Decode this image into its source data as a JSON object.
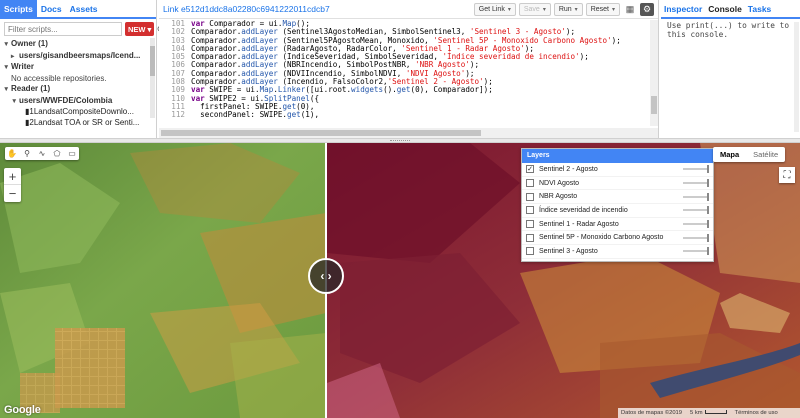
{
  "left_panel": {
    "tabs": [
      "Scripts",
      "Docs",
      "Assets"
    ],
    "filter_placeholder": "Filter scripts...",
    "new_button": "NEW",
    "owner": "Owner (1)",
    "owner_repo": "users/gisandbeersmaps/Icend...",
    "writer": "Writer",
    "writer_empty": "No accessible repositories.",
    "reader": "Reader (1)",
    "reader_repo": "users/WWFDE/Colombia",
    "file1": "1LandsatCompositeDownlo...",
    "file2": "2Landsat TOA or SR or Senti..."
  },
  "center_panel": {
    "link_title": "Link e512d1ddc8a02280c6941222011cdcb7",
    "get_link": "Get Link",
    "save": "Save",
    "run": "Run",
    "reset": "Reset",
    "code_lines": [
      {
        "n": "101",
        "t": "var Comparador = ui.Map();"
      },
      {
        "n": "102",
        "t": "Comparador.addLayer (Sentinel3AgostoMedian, SimbolSentinel3, 'Sentinel 3 - Agosto');"
      },
      {
        "n": "103",
        "t": "Comparador.addLayer (Sentinel5PAgostoMean, Monoxido, 'Sentinel 5P - Monoxido Carbono Agosto');"
      },
      {
        "n": "104",
        "t": "Comparador.addLayer (RadarAgosto, RadarColor, 'Sentinel 1 - Radar Agosto');"
      },
      {
        "n": "105",
        "t": "Comparador.addLayer (IndiceSeveridad, SimbolSeveridad, 'Índice severidad de incendio');"
      },
      {
        "n": "106",
        "t": "Comparador.addLayer (NBRIncendio, SimbolPostNBR, 'NBR Agosto');"
      },
      {
        "n": "107",
        "t": "Comparador.addLayer (NDVIIncendio, SimbolNDVI, 'NDVI Agosto');"
      },
      {
        "n": "108",
        "t": "Comparador.addLayer (Incendio, FalsoColor2,'Sentinel 2 - Agosto');"
      },
      {
        "n": "109",
        "t": "var SWIPE = ui.Map.Linker([ui.root.widgets().get(0), Comparador]);"
      },
      {
        "n": "110",
        "t": "var SWIPE2 = ui.SplitPanel({"
      },
      {
        "n": "111",
        "t": "  firstPanel: SWIPE.get(0),"
      },
      {
        "n": "112",
        "t": "  secondPanel: SWIPE.get(1),"
      }
    ]
  },
  "right_panel": {
    "tabs": [
      "Inspector",
      "Console",
      "Tasks"
    ],
    "console_text": "Use print(...) to write to this console."
  },
  "map": {
    "layers_title": "Layers",
    "layers": [
      {
        "name": "Sentinel 2 - Agosto",
        "checked": true
      },
      {
        "name": "NDVI Agosto",
        "checked": false
      },
      {
        "name": "NBR Agosto",
        "checked": false
      },
      {
        "name": "Índice severidad de incendio",
        "checked": false
      },
      {
        "name": "Sentinel 1 - Radar Agosto",
        "checked": false
      },
      {
        "name": "Sentinel 5P - Monoxido Carbono Agosto",
        "checked": false
      },
      {
        "name": "Sentinel 3 - Agosto",
        "checked": false
      }
    ],
    "map_type_active": "Mapa",
    "map_type_other": "Satélite",
    "google_logo": "Google",
    "attribution": "Datos de mapas ©2019",
    "scale": "5 km",
    "terms": "Términos de uso",
    "colors": {
      "accent": "#4285f4",
      "red_button": "#d32f2f"
    }
  }
}
